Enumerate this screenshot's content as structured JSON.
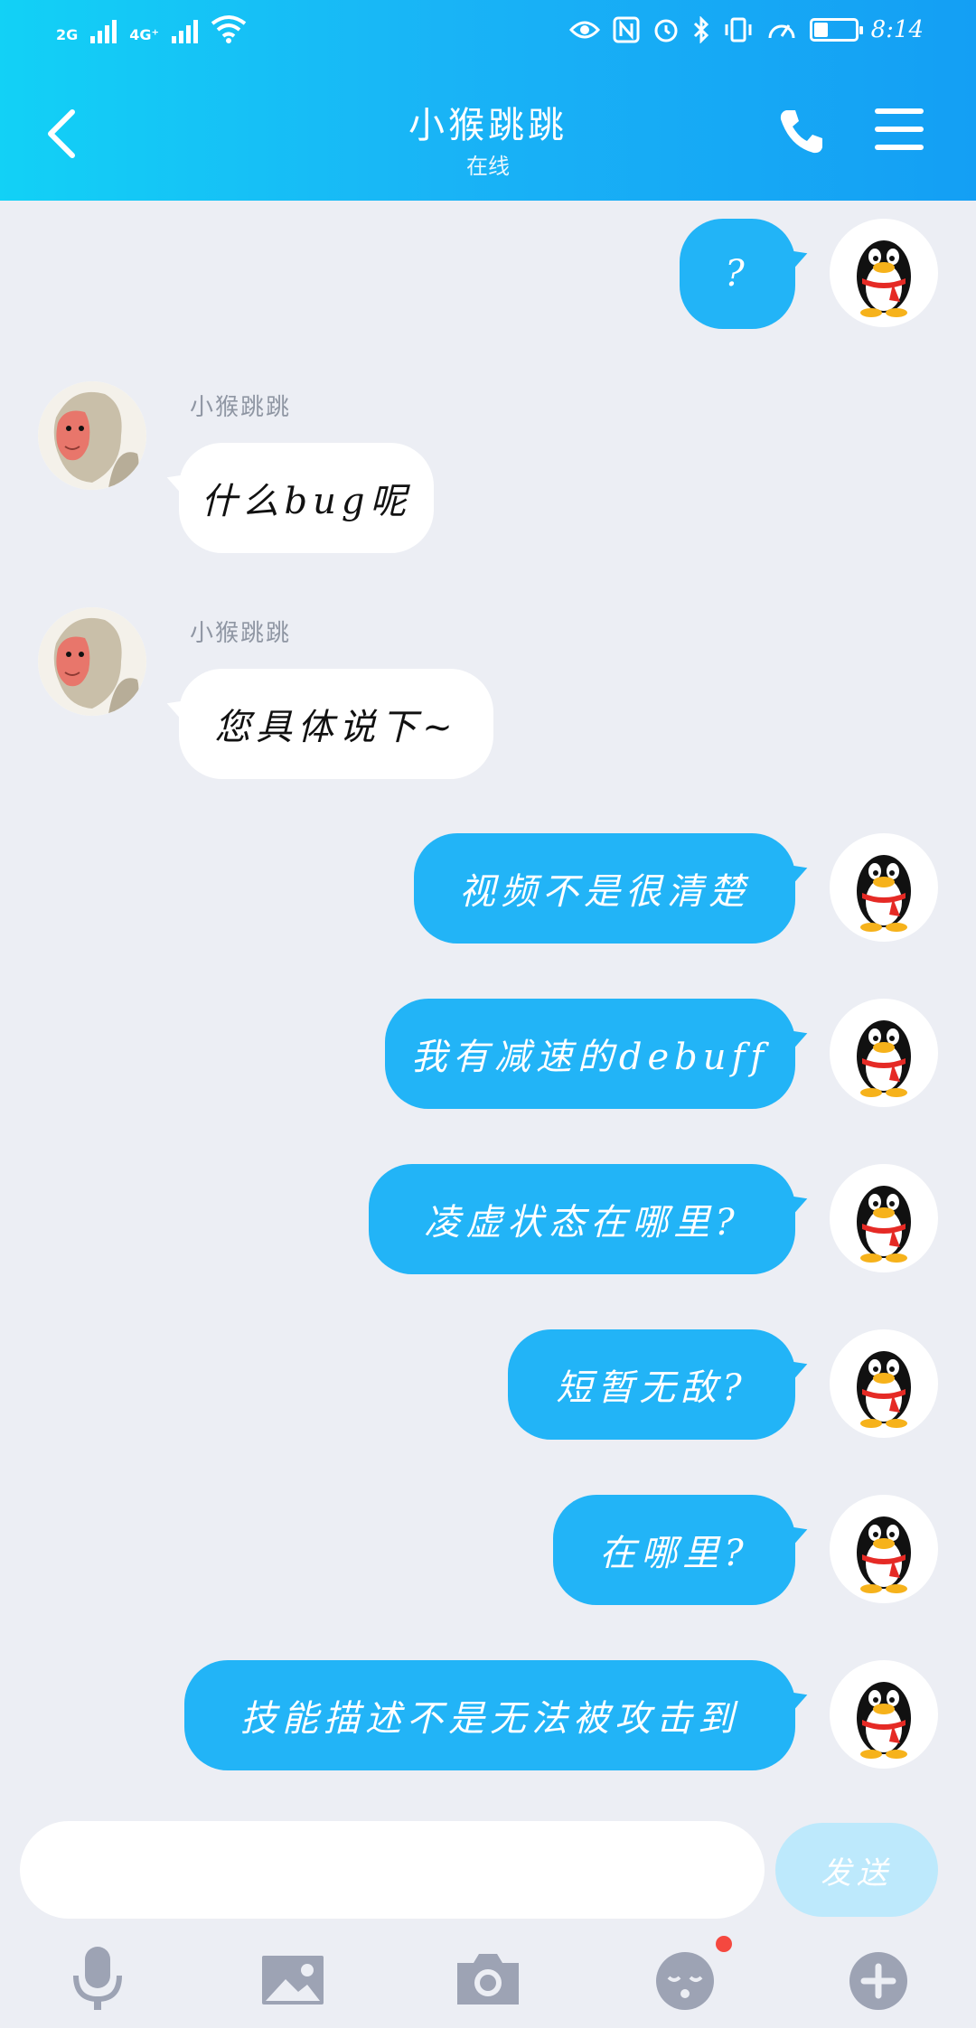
{
  "status_bar": {
    "network_1": "2G",
    "network_2": "4G⁺",
    "time": "8:14",
    "battery_level": 0.35
  },
  "header": {
    "title": "小猴跳跳",
    "subtitle": "在线"
  },
  "messages": [
    {
      "direction": "out",
      "text": "?"
    },
    {
      "direction": "in",
      "sender": "小猴跳跳",
      "text": "什么bug呢"
    },
    {
      "direction": "in",
      "sender": "小猴跳跳",
      "text": "您具体说下~"
    },
    {
      "direction": "out",
      "text": "视频不是很清楚"
    },
    {
      "direction": "out",
      "text": "我有减速的debuff"
    },
    {
      "direction": "out",
      "text": "凌虚状态在哪里?"
    },
    {
      "direction": "out",
      "text": "短暂无敌?"
    },
    {
      "direction": "out",
      "text": "在哪里?"
    },
    {
      "direction": "out",
      "text": "技能描述不是无法被攻击到"
    }
  ],
  "input": {
    "value": "",
    "send_label": "发送"
  },
  "toolbar": {
    "items": [
      "microphone-icon",
      "image-icon",
      "camera-icon",
      "emoji-icon",
      "plus-icon"
    ],
    "emoji_badge_color": "#F5483F"
  },
  "colors": {
    "accent": "#22B4F7",
    "background": "#ECEEF4",
    "header_start": "#12D1F6",
    "header_end": "#149FF4"
  }
}
